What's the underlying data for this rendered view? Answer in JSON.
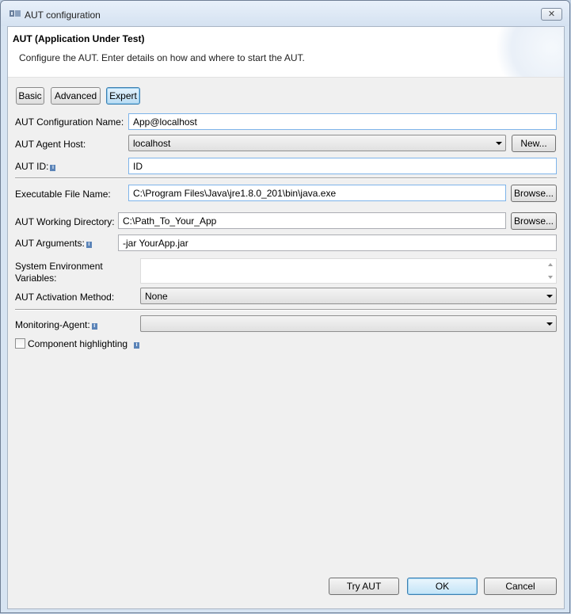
{
  "window": {
    "title": "AUT configuration",
    "close_glyph": "✕"
  },
  "banner": {
    "title": "AUT (Application Under Test)",
    "description": "Configure the AUT. Enter details on how and where to start the AUT."
  },
  "mode_tabs": {
    "basic": "Basic",
    "advanced": "Advanced",
    "expert": "Expert",
    "selected": "Expert"
  },
  "form": {
    "config_name": {
      "label": "AUT Configuration Name:",
      "value": "App@localhost"
    },
    "agent_host": {
      "label": "AUT Agent Host:",
      "value": "localhost",
      "new_button": "New..."
    },
    "aut_id": {
      "label": "AUT ID:",
      "value": "ID"
    },
    "executable": {
      "label": "Executable File Name:",
      "value": "C:\\Program Files\\Java\\jre1.8.0_201\\bin\\java.exe",
      "browse_button": "Browse..."
    },
    "working_dir": {
      "label": "AUT Working Directory:",
      "value": "C:\\Path_To_Your_App",
      "browse_button": "Browse..."
    },
    "arguments": {
      "label": "AUT Arguments:",
      "value": "-jar YourApp.jar"
    },
    "env_vars": {
      "label_line1": "System Environment",
      "label_line2": "Variables:",
      "value": ""
    },
    "activation": {
      "label": "AUT Activation Method:",
      "value": "None"
    },
    "monitoring": {
      "label": "Monitoring-Agent:",
      "value": ""
    },
    "highlighting": {
      "label": "Component highlighting",
      "checked": false
    }
  },
  "footer": {
    "try_aut": "Try AUT",
    "ok": "OK",
    "cancel": "Cancel"
  },
  "icons": {
    "info": "i"
  },
  "colors": {
    "accent": "#3c7fb1",
    "info_icon": "#5b84b8"
  }
}
